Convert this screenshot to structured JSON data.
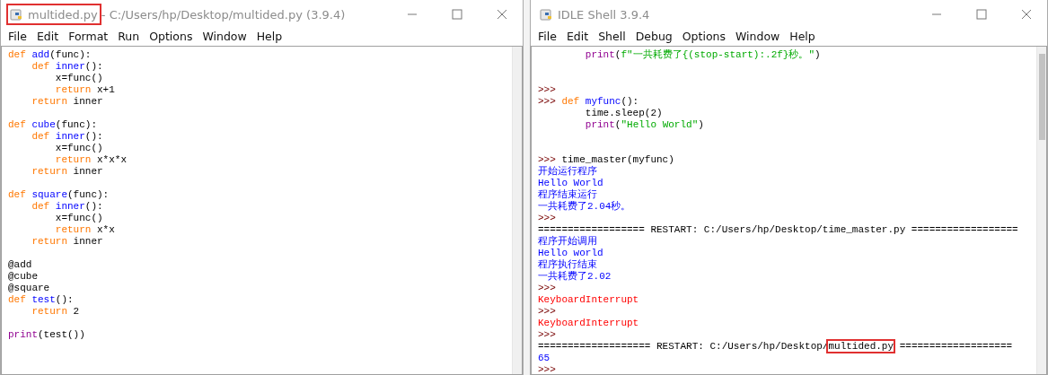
{
  "windows": [
    {
      "kind": "editor",
      "title": {
        "filename": "multided.py",
        "rest": " - C:/Users/hp/Desktop/multided.py (3.9.4)",
        "highlighted": true
      },
      "menu": [
        "File",
        "Edit",
        "Format",
        "Run",
        "Options",
        "Window",
        "Help"
      ],
      "lines": [
        {
          "kind": "code",
          "tokens": [
            {
              "text": "def ",
              "kind": "kw"
            },
            {
              "text": "add",
              "kind": "def"
            },
            {
              "text": "(func):",
              "kind": "plain"
            }
          ]
        },
        {
          "kind": "code",
          "tokens": [
            {
              "text": "    def ",
              "kind": "kw"
            },
            {
              "text": "inner",
              "kind": "def"
            },
            {
              "text": "():",
              "kind": "plain"
            }
          ]
        },
        {
          "kind": "code",
          "tokens": [
            {
              "text": "        x=func()",
              "kind": "plain"
            }
          ]
        },
        {
          "kind": "code",
          "tokens": [
            {
              "text": "        return",
              "kind": "kw"
            },
            {
              "text": " x+1",
              "kind": "plain"
            }
          ]
        },
        {
          "kind": "code",
          "tokens": [
            {
              "text": "    return",
              "kind": "kw"
            },
            {
              "text": " inner",
              "kind": "plain"
            }
          ]
        },
        {
          "kind": "blank"
        },
        {
          "kind": "code",
          "tokens": [
            {
              "text": "def ",
              "kind": "kw"
            },
            {
              "text": "cube",
              "kind": "def"
            },
            {
              "text": "(func):",
              "kind": "plain"
            }
          ]
        },
        {
          "kind": "code",
          "tokens": [
            {
              "text": "    def ",
              "kind": "kw"
            },
            {
              "text": "inner",
              "kind": "def"
            },
            {
              "text": "():",
              "kind": "plain"
            }
          ]
        },
        {
          "kind": "code",
          "tokens": [
            {
              "text": "        x=func()",
              "kind": "plain"
            }
          ]
        },
        {
          "kind": "code",
          "tokens": [
            {
              "text": "        return",
              "kind": "kw"
            },
            {
              "text": " x*x*x",
              "kind": "plain"
            }
          ]
        },
        {
          "kind": "code",
          "tokens": [
            {
              "text": "    return",
              "kind": "kw"
            },
            {
              "text": " inner",
              "kind": "plain"
            }
          ]
        },
        {
          "kind": "blank"
        },
        {
          "kind": "code",
          "tokens": [
            {
              "text": "def ",
              "kind": "kw"
            },
            {
              "text": "square",
              "kind": "def"
            },
            {
              "text": "(func):",
              "kind": "plain"
            }
          ]
        },
        {
          "kind": "code",
          "tokens": [
            {
              "text": "    def ",
              "kind": "kw"
            },
            {
              "text": "inner",
              "kind": "def"
            },
            {
              "text": "():",
              "kind": "plain"
            }
          ]
        },
        {
          "kind": "code",
          "tokens": [
            {
              "text": "        x=func()",
              "kind": "plain"
            }
          ]
        },
        {
          "kind": "code",
          "tokens": [
            {
              "text": "        return",
              "kind": "kw"
            },
            {
              "text": " x*x",
              "kind": "plain"
            }
          ]
        },
        {
          "kind": "code",
          "tokens": [
            {
              "text": "    return",
              "kind": "kw"
            },
            {
              "text": " inner",
              "kind": "plain"
            }
          ]
        },
        {
          "kind": "blank"
        },
        {
          "kind": "code",
          "tokens": [
            {
              "text": "@add",
              "kind": "plain"
            }
          ]
        },
        {
          "kind": "code",
          "tokens": [
            {
              "text": "@cube",
              "kind": "plain"
            }
          ]
        },
        {
          "kind": "code",
          "tokens": [
            {
              "text": "@square",
              "kind": "plain"
            }
          ]
        },
        {
          "kind": "code",
          "tokens": [
            {
              "text": "def ",
              "kind": "kw"
            },
            {
              "text": "test",
              "kind": "def"
            },
            {
              "text": "():",
              "kind": "plain"
            }
          ]
        },
        {
          "kind": "code",
          "tokens": [
            {
              "text": "    return",
              "kind": "kw"
            },
            {
              "text": " 2",
              "kind": "plain"
            }
          ]
        },
        {
          "kind": "blank"
        },
        {
          "kind": "code",
          "tokens": [
            {
              "text": "print",
              "kind": "builtin"
            },
            {
              "text": "(test())",
              "kind": "plain"
            }
          ]
        }
      ]
    },
    {
      "kind": "shell",
      "title": {
        "filename": "IDLE Shell 3.9.4",
        "highlighted": false
      },
      "menu": [
        "File",
        "Edit",
        "Shell",
        "Debug",
        "Options",
        "Window",
        "Help"
      ],
      "lines": [
        {
          "kind": "code",
          "tokens": [
            {
              "text": "        print",
              "kind": "builtin"
            },
            {
              "text": "(",
              "kind": "plain"
            },
            {
              "text": "f\"一共耗费了{(stop-start):.2f}秒。\"",
              "kind": "str"
            },
            {
              "text": ")",
              "kind": "plain"
            }
          ]
        },
        {
          "kind": "blank"
        },
        {
          "kind": "blank"
        },
        {
          "kind": "code",
          "tokens": [
            {
              "text": ">>>",
              "kind": "prompt"
            }
          ]
        },
        {
          "kind": "code",
          "tokens": [
            {
              "text": ">>> ",
              "kind": "prompt"
            },
            {
              "text": "def ",
              "kind": "kw"
            },
            {
              "text": "myfunc",
              "kind": "def"
            },
            {
              "text": "():",
              "kind": "plain"
            }
          ]
        },
        {
          "kind": "code",
          "tokens": [
            {
              "text": "        time.sleep(2)",
              "kind": "plain"
            }
          ]
        },
        {
          "kind": "code",
          "tokens": [
            {
              "text": "        print",
              "kind": "builtin"
            },
            {
              "text": "(",
              "kind": "plain"
            },
            {
              "text": "\"Hello World\"",
              "kind": "str"
            },
            {
              "text": ")",
              "kind": "plain"
            }
          ]
        },
        {
          "kind": "blank"
        },
        {
          "kind": "blank"
        },
        {
          "kind": "code",
          "tokens": [
            {
              "text": ">>> ",
              "kind": "prompt"
            },
            {
              "text": "time_master(myfunc)",
              "kind": "plain"
            }
          ]
        },
        {
          "kind": "code",
          "tokens": [
            {
              "text": "开始运行程序",
              "kind": "stdout"
            }
          ]
        },
        {
          "kind": "code",
          "tokens": [
            {
              "text": "Hello World",
              "kind": "stdout"
            }
          ]
        },
        {
          "kind": "code",
          "tokens": [
            {
              "text": "程序结束运行",
              "kind": "stdout"
            }
          ]
        },
        {
          "kind": "code",
          "tokens": [
            {
              "text": "一共耗费了2.04秒。",
              "kind": "stdout"
            }
          ]
        },
        {
          "kind": "code",
          "tokens": [
            {
              "text": ">>>",
              "kind": "prompt"
            }
          ]
        },
        {
          "kind": "code",
          "tokens": [
            {
              "text": "================== RESTART: C:/Users/hp/Desktop/time_master.py ==================",
              "kind": "plain"
            }
          ]
        },
        {
          "kind": "code",
          "tokens": [
            {
              "text": "程序开始调用",
              "kind": "stdout"
            }
          ]
        },
        {
          "kind": "code",
          "tokens": [
            {
              "text": "Hello world",
              "kind": "stdout"
            }
          ]
        },
        {
          "kind": "code",
          "tokens": [
            {
              "text": "程序执行结束",
              "kind": "stdout"
            }
          ]
        },
        {
          "kind": "code",
          "tokens": [
            {
              "text": "一共耗费了2.02",
              "kind": "stdout"
            }
          ]
        },
        {
          "kind": "code",
          "tokens": [
            {
              "text": ">>>",
              "kind": "prompt"
            }
          ]
        },
        {
          "kind": "code",
          "tokens": [
            {
              "text": "KeyboardInterrupt",
              "kind": "error"
            }
          ]
        },
        {
          "kind": "code",
          "tokens": [
            {
              "text": ">>>",
              "kind": "prompt"
            }
          ]
        },
        {
          "kind": "code",
          "tokens": [
            {
              "text": "KeyboardInterrupt",
              "kind": "error"
            }
          ]
        },
        {
          "kind": "code",
          "tokens": [
            {
              "text": ">>>",
              "kind": "prompt"
            }
          ]
        },
        {
          "kind": "code",
          "tokens": [
            {
              "text": "=================== RESTART: C:/Users/hp/Desktop/",
              "kind": "plain"
            },
            {
              "text": "multided.py",
              "kind": "plain",
              "boxed": true
            },
            {
              "text": " ===================",
              "kind": "plain"
            }
          ]
        },
        {
          "kind": "code",
          "tokens": [
            {
              "text": "65",
              "kind": "stdout"
            }
          ]
        },
        {
          "kind": "code",
          "tokens": [
            {
              "text": ">>>",
              "kind": "prompt"
            }
          ]
        }
      ]
    }
  ]
}
